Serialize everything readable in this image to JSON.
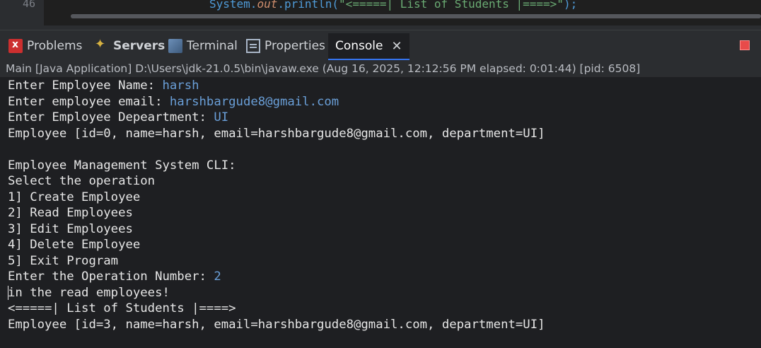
{
  "editor": {
    "line_number": "46",
    "code_prefix": "System.",
    "code_keyword": "out",
    "code_middle": ".println(",
    "code_string": "\"<=====| List of Students |====>\"",
    "code_suffix": ");"
  },
  "tabs": [
    {
      "label": "Problems",
      "icon": "problems-icon",
      "active": false
    },
    {
      "label": "Servers",
      "icon": "servers-icon",
      "active": false
    },
    {
      "label": "Terminal",
      "icon": "terminal-icon",
      "active": false
    },
    {
      "label": "Properties",
      "icon": "properties-icon",
      "active": false
    },
    {
      "label": "Console",
      "icon": "console-icon",
      "active": true
    }
  ],
  "status": "Main [Java Application] D:\\Users\\jdk-21.0.5\\bin\\javaw.exe  (Aug 16, 2025, 12:12:56 PM elapsed: 0:01:44) [pid: 6508]",
  "console": {
    "lines": [
      {
        "text": "Enter Employee Name: ",
        "input": "harsh"
      },
      {
        "text": "Enter employee email: ",
        "input": "harshbargude8@gmail.com"
      },
      {
        "text": "Enter Employee Depeartment: ",
        "input": "UI"
      },
      {
        "text": "Employee [id=0, name=harsh, email=harshbargude8@gmail.com, department=UI]",
        "input": ""
      },
      {
        "text": "",
        "input": ""
      },
      {
        "text": "Employee Management System CLI:",
        "input": ""
      },
      {
        "text": "Select the operation",
        "input": ""
      },
      {
        "text": "1] Create Employee",
        "input": ""
      },
      {
        "text": "2] Read Employees",
        "input": ""
      },
      {
        "text": "3] Edit Employees",
        "input": ""
      },
      {
        "text": "4] Delete Employee",
        "input": ""
      },
      {
        "text": "5] Exit Program",
        "input": ""
      },
      {
        "text": "Enter the Operation Number: ",
        "input": "2"
      },
      {
        "text": "in the read employees!",
        "input": ""
      },
      {
        "text": "<=====| List of Students |====>",
        "input": ""
      },
      {
        "text": "Employee [id=3, name=harsh, email=harshbargude8@gmail.com, department=UI]",
        "input": ""
      }
    ]
  }
}
